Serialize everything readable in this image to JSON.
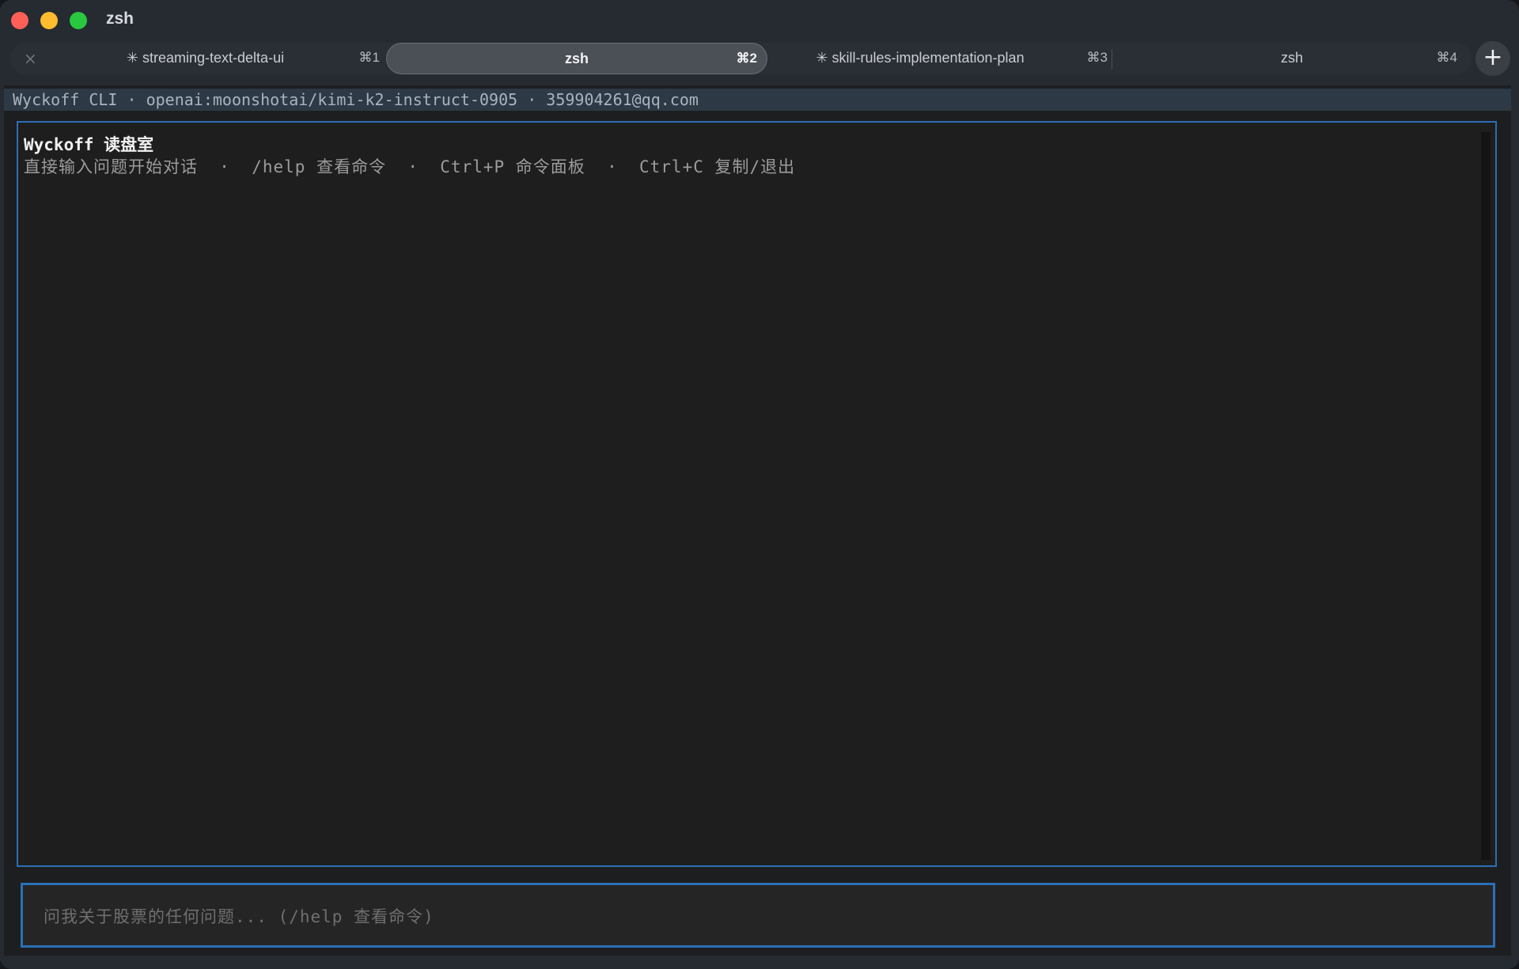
{
  "window": {
    "title": "zsh"
  },
  "tabs": [
    {
      "label": "✳ streaming-text-delta-ui",
      "shortcut": "⌘1",
      "active": false
    },
    {
      "label": "zsh",
      "shortcut": "⌘2",
      "active": true
    },
    {
      "label": "✳ skill-rules-implementation-plan",
      "shortcut": "⌘3",
      "active": false
    },
    {
      "label": "zsh",
      "shortcut": "⌘4",
      "active": false
    }
  ],
  "icons": {
    "tab_close": "×",
    "new_tab": "+"
  },
  "status_line": "Wyckoff CLI · openai:moonshotai/kimi-k2-instruct-0905 · 359904261@qq.com",
  "chat": {
    "title": "Wyckoff 读盘室",
    "hint": "直接输入问题开始对话  ·  /help 查看命令  ·  Ctrl+P 命令面板  ·  Ctrl+C 复制/退出"
  },
  "input": {
    "placeholder": "问我关于股票的任何问题... (/help 查看命令)"
  },
  "colors": {
    "accent_border": "#2b6fb6",
    "traffic_close": "#fe5f57",
    "traffic_min": "#febc2e",
    "traffic_max": "#28c840"
  }
}
